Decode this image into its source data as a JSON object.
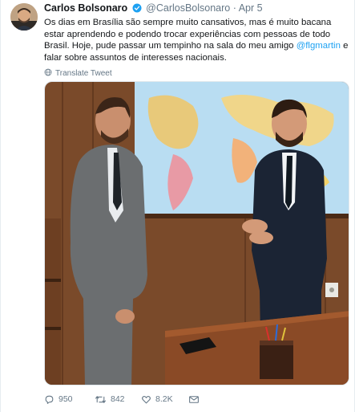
{
  "author": {
    "name": "Carlos Bolsonaro",
    "handle": "@CarlosBolsonaro",
    "separator": "·",
    "time": "Apr 5"
  },
  "tweet": {
    "text_before": "Os dias em Brasília são sempre muito cansativos, mas é muito bacana estar aprendendo e podendo trocar experiências com pessoas de todo Brasil. Hoje, pude passar um tempinho na sala do meu amigo ",
    "mention": "@flgmartin",
    "text_after": " e falar sobre assuntos de interesses nacionais.",
    "translate_label": "Translate Tweet"
  },
  "actions": {
    "replies": "950",
    "retweets": "842",
    "likes": "8.2K"
  },
  "icons": {
    "verified": "verified-badge-icon",
    "translate": "globe-icon",
    "reply": "reply-icon",
    "retweet": "retweet-icon",
    "like": "heart-icon",
    "message": "envelope-icon"
  },
  "colors": {
    "link": "#1da1f2",
    "secondary_text": "#657786",
    "verified": "#1da1f2"
  }
}
